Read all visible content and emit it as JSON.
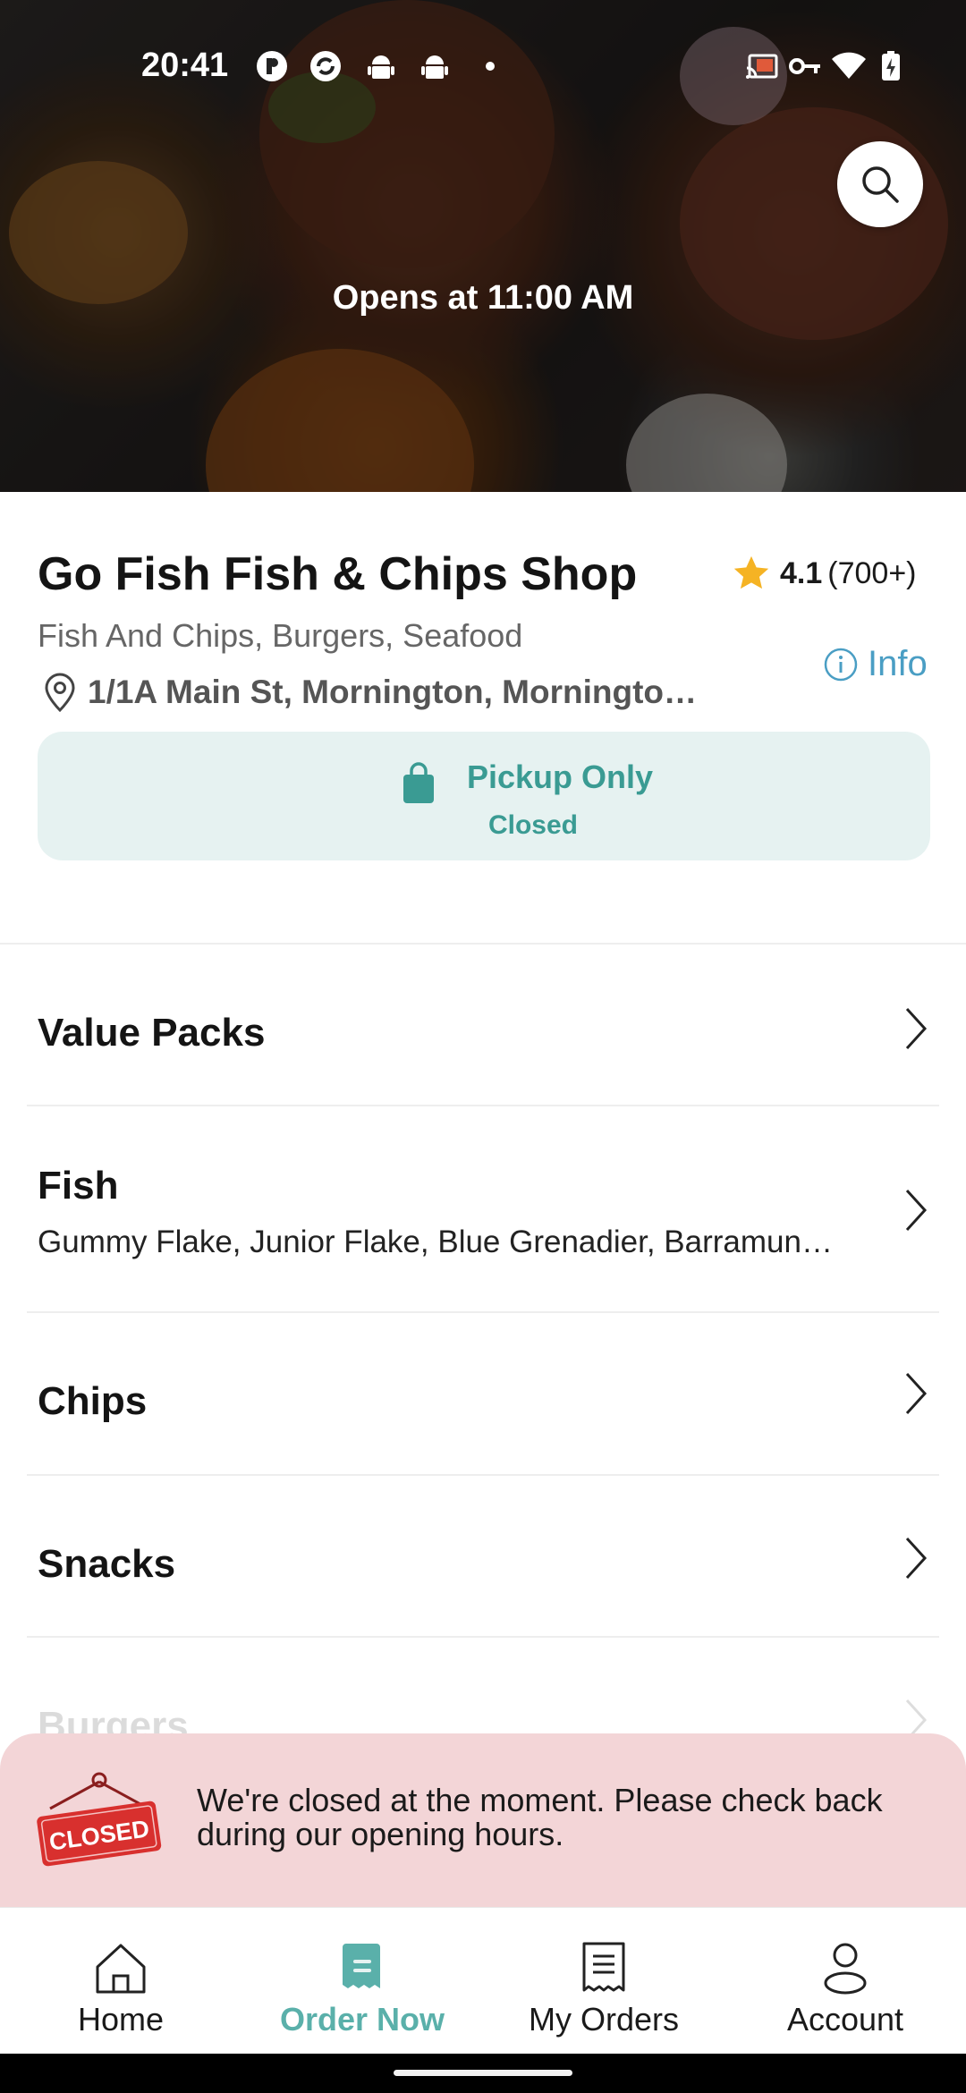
{
  "status_bar": {
    "time": "20:41"
  },
  "hero": {
    "opens_text": "Opens at 11:00 AM"
  },
  "restaurant": {
    "name": "Go Fish Fish & Chips Shop",
    "rating": "4.1",
    "rating_count": "(700+)",
    "cuisines": "Fish And Chips, Burgers, Seafood",
    "info_label": "Info",
    "address": "1/1A Main St, Mornington, Morningto…"
  },
  "pickup": {
    "title": "Pickup Only",
    "status": "Closed"
  },
  "menu": [
    {
      "name": "Value Packs",
      "desc": ""
    },
    {
      "name": "Fish",
      "desc": "Gummy Flake, Junior Flake, Blue Grenadier, Barramun…"
    },
    {
      "name": "Chips",
      "desc": ""
    },
    {
      "name": "Snacks",
      "desc": ""
    },
    {
      "name": "Burgers",
      "desc": ""
    }
  ],
  "closed_banner": {
    "sign_text": "CLOSED",
    "message": "We're closed at the moment. Please check back during our opening hours."
  },
  "nav": [
    {
      "label": "Home",
      "icon": "home-icon"
    },
    {
      "label": "Order Now",
      "icon": "order-icon",
      "active": true
    },
    {
      "label": "My Orders",
      "icon": "receipt-icon"
    },
    {
      "label": "Account",
      "icon": "account-icon"
    }
  ],
  "colors": {
    "accent": "#3a9b93",
    "info_blue": "#4a9ec4",
    "banner_bg": "#f3d5d7",
    "star": "#f5b324"
  }
}
